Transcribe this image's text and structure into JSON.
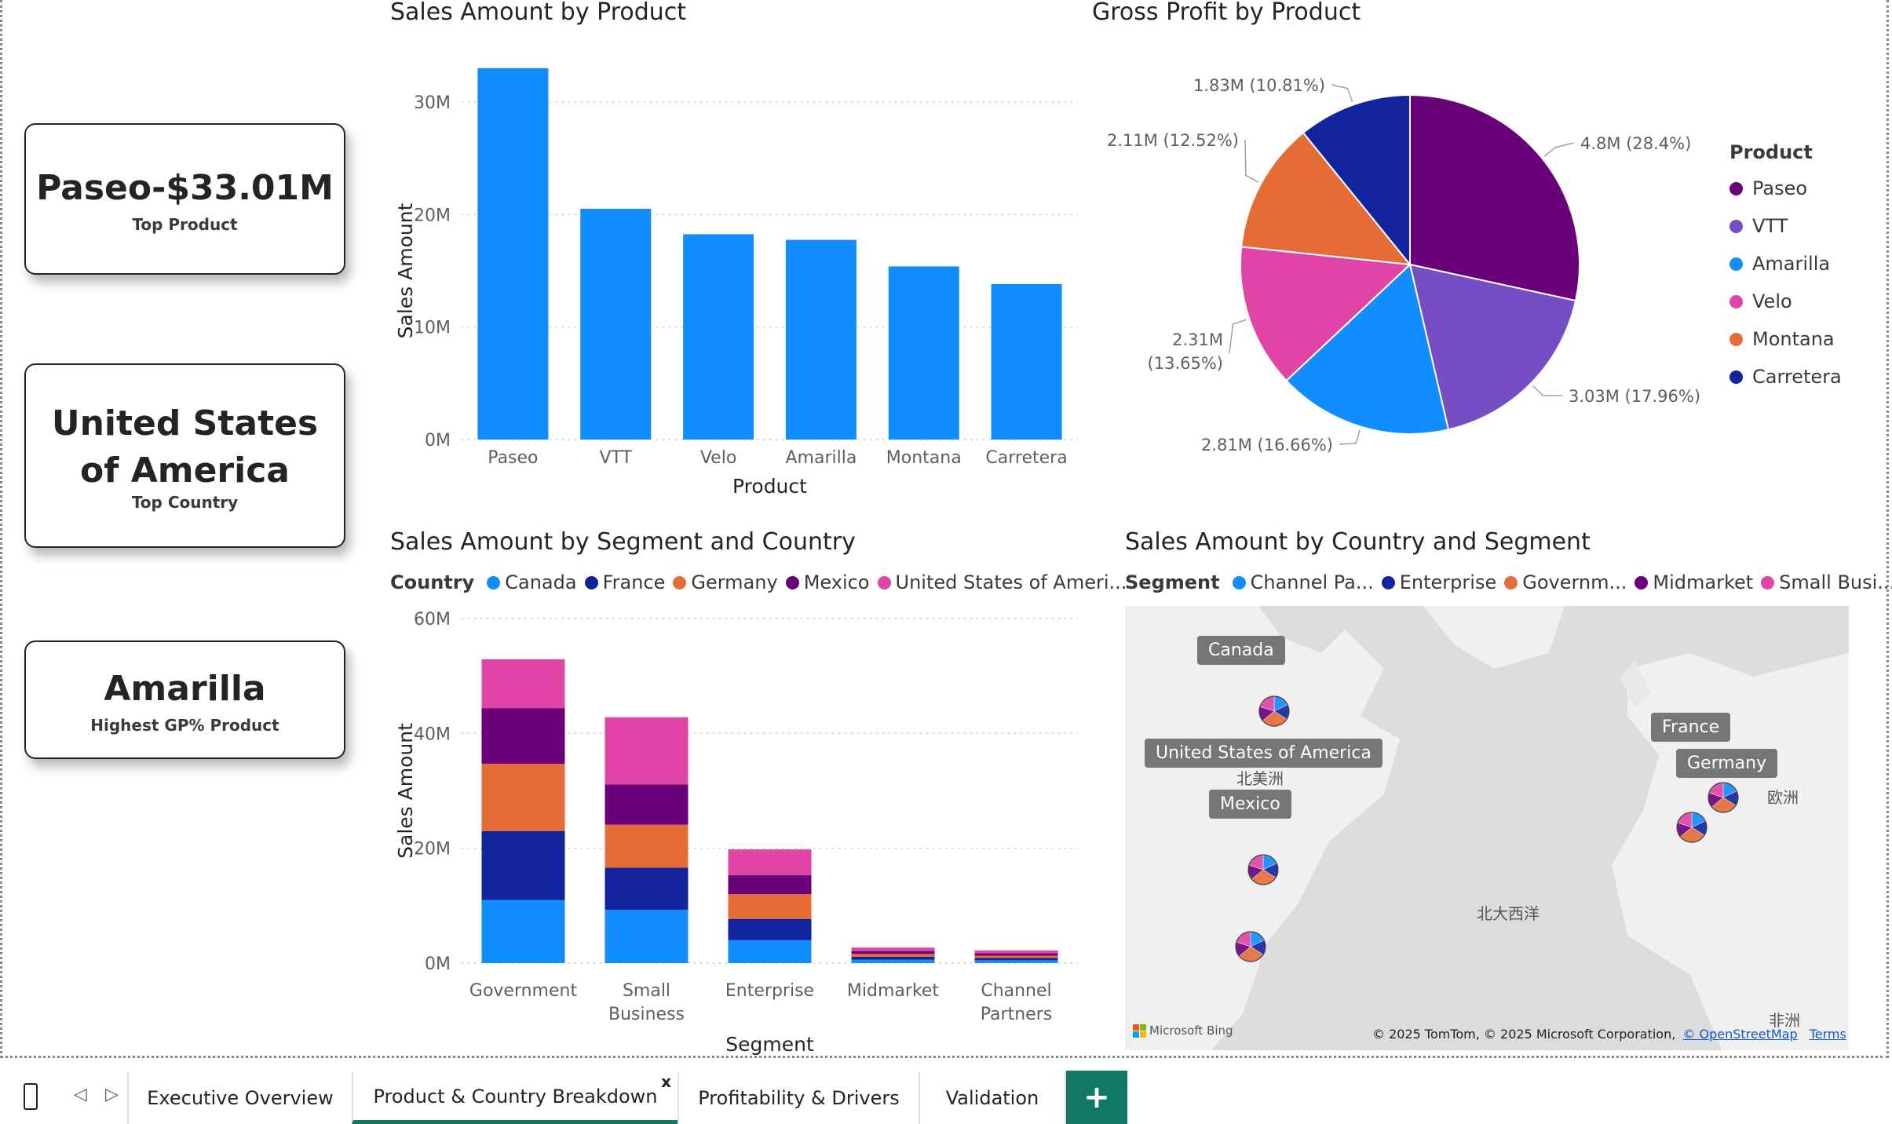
{
  "cards": [
    {
      "value": "Paseo-$33.01M",
      "label": "Top Product"
    },
    {
      "value": "United States of America",
      "label": "Top Country"
    },
    {
      "value": "Amarilla",
      "label": "Highest GP% Product"
    }
  ],
  "colors": {
    "blue": "#118DFF",
    "navy": "#12239E",
    "orange": "#E66C37",
    "purple": "#6B007B",
    "pink": "#E044A7",
    "violet": "#744EC2",
    "teal": "#117865"
  },
  "bar_chart": {
    "title": "Sales Amount by Product",
    "chart_data": {
      "type": "bar",
      "categories": [
        "Paseo",
        "VTT",
        "Velo",
        "Amarilla",
        "Montana",
        "Carretera"
      ],
      "values": [
        33.01,
        20.51,
        18.25,
        17.75,
        15.39,
        13.82
      ],
      "xlabel": "Product",
      "ylabel": "Sales Amount",
      "ylim": [
        0,
        33
      ],
      "ticks": [
        {
          "v": 0,
          "label": "0M"
        },
        {
          "v": 10,
          "label": "10M"
        },
        {
          "v": 20,
          "label": "20M"
        },
        {
          "v": 30,
          "label": "30M"
        }
      ],
      "grid": true
    }
  },
  "pie_chart": {
    "title": "Gross Profit by Product",
    "legend_title": "Product",
    "legend": [
      "Paseo",
      "VTT",
      "Amarilla",
      "Velo",
      "Montana",
      "Carretera"
    ],
    "chart_data": {
      "type": "pie",
      "labels": [
        "Paseo",
        "VTT",
        "Amarilla",
        "Velo",
        "Montana",
        "Carretera"
      ],
      "values": [
        4.8,
        3.03,
        2.81,
        2.31,
        2.11,
        1.83
      ],
      "data_labels": [
        "4.8M (28.4%)",
        "3.03M (17.96%)",
        "2.81M (16.66%)",
        "2.31M (13.65%)",
        "2.11M (12.52%)",
        "1.83M (10.81%)"
      ],
      "legend_position": "right"
    }
  },
  "stacked_chart": {
    "title": "Sales Amount by Segment and Country",
    "legend_title": "Country",
    "legend": [
      "Canada",
      "France",
      "Germany",
      "Mexico",
      "United States of Ameri..."
    ],
    "chart_data": {
      "type": "bar",
      "stacked": true,
      "categories": [
        "Government",
        "Small Business",
        "Enterprise",
        "Midmarket",
        "Channel Partners"
      ],
      "category_lines": [
        [
          "Government"
        ],
        [
          "Small",
          "Business"
        ],
        [
          "Enterprise"
        ],
        [
          "Midmarket"
        ],
        [
          "Channel",
          "Partners"
        ]
      ],
      "series": [
        {
          "name": "Canada",
          "values": [
            11.0,
            9.3,
            4.0,
            0.6,
            0.5
          ]
        },
        {
          "name": "France",
          "values": [
            12.0,
            7.3,
            3.7,
            0.5,
            0.4
          ]
        },
        {
          "name": "Germany",
          "values": [
            11.7,
            7.5,
            4.3,
            0.5,
            0.4
          ]
        },
        {
          "name": "Mexico",
          "values": [
            9.7,
            7.0,
            3.3,
            0.5,
            0.4
          ]
        },
        {
          "name": "United States of America",
          "values": [
            8.5,
            11.7,
            4.5,
            0.6,
            0.5
          ]
        }
      ],
      "xlabel": "Segment",
      "ylabel": "Sales Amount",
      "ylim": [
        0,
        60
      ],
      "ticks": [
        {
          "v": 0,
          "label": "0M"
        },
        {
          "v": 20,
          "label": "20M"
        },
        {
          "v": 40,
          "label": "40M"
        },
        {
          "v": 60,
          "label": "60M"
        }
      ],
      "grid": true
    }
  },
  "map": {
    "title": "Sales Amount by Country and Segment",
    "legend_title": "Segment",
    "legend": [
      "Channel Pa...",
      "Enterprise",
      "Governm...",
      "Midmarket",
      "Small Busi..."
    ],
    "countries": [
      "Canada",
      "United States of America",
      "Mexico",
      "France",
      "Germany"
    ],
    "regions": [
      "北美洲",
      "欧洲",
      "北大西洋",
      "非洲"
    ],
    "bing": "Microsoft Bing",
    "copyright": "© 2025 TomTom, © 2025 Microsoft Corporation,",
    "osm_link": "© OpenStreetMap",
    "terms_link": "Terms"
  },
  "tabs": {
    "items": [
      "Executive Overview",
      "Product & Country Breakdown",
      "Profitability & Drivers",
      "Validation"
    ],
    "active": "Product & Country Breakdown",
    "close": "x",
    "add": "+"
  }
}
